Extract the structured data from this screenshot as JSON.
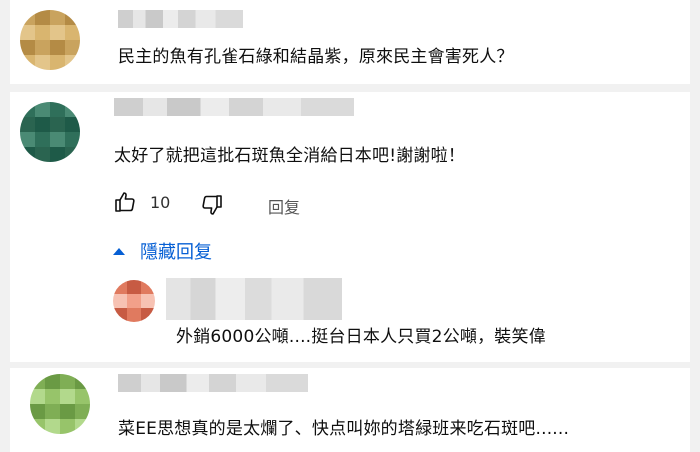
{
  "comments": [
    {
      "text": "民主的魚有孔雀石綠和結晶紫，原來民主會害死人？",
      "avatar_colors": [
        "#c9a35e",
        "#d9b56f",
        "#b48b45",
        "#e3c58a"
      ]
    },
    {
      "text": "太好了就把這批石斑魚全消給日本吧!謝謝啦！",
      "avatar_colors": [
        "#2f6f5a",
        "#1e5a48",
        "#4a8a74",
        "#2a6450"
      ],
      "likes": "10",
      "reply_label": "回复",
      "hide_replies_label": "隱藏回复",
      "reply": {
        "text": "外銷6000公噸....挺台日本人只買2公噸，裝笑偉",
        "avatar_colors": [
          "#e07a5f",
          "#f2a08a",
          "#c75b43",
          "#f7c2b3"
        ]
      }
    },
    {
      "text": "菜EE思想真的是太爛了、快点叫妳的塔緑班来吃石斑吧......",
      "avatar_colors": [
        "#7fae55",
        "#97c46a",
        "#6a9a44",
        "#b2d98c"
      ]
    }
  ],
  "icons": {
    "like": "thumbs-up-icon",
    "dislike": "thumbs-down-icon",
    "collapse": "caret-up-icon"
  },
  "colors": {
    "link_blue": "#065fd4",
    "page_bg": "#f1f1f1"
  }
}
